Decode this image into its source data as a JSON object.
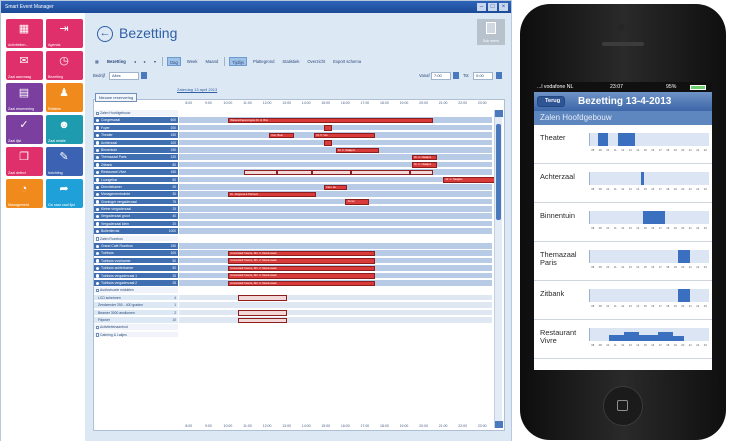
{
  "desktop": {
    "window_title": "Smart Event Manager",
    "tiles": [
      {
        "label": "Activiteiten...",
        "color": "#e0306b",
        "icon": "grid-icon",
        "glyph": "▦"
      },
      {
        "label": "Agenda",
        "color": "#e0306b",
        "icon": "door-icon",
        "glyph": "⇥"
      },
      {
        "label": "Zaal aanvraag",
        "color": "#e0306b",
        "icon": "mail-icon",
        "glyph": "✉"
      },
      {
        "label": "Bezetting",
        "color": "#e0306b",
        "icon": "clock-icon",
        "glyph": "◷"
      },
      {
        "label": "Zaal reservering",
        "color": "#7b3fa0",
        "icon": "document-icon",
        "glyph": "▤"
      },
      {
        "label": "Relaties",
        "color": "#f08a1d",
        "icon": "person-icon",
        "glyph": "♟"
      },
      {
        "label": "Zaal lijst",
        "color": "#7b3fa0",
        "icon": "check-icon",
        "glyph": "✓"
      },
      {
        "label": "Zaal relatie",
        "color": "#1f9bb0",
        "icon": "people-icon",
        "glyph": "☻"
      },
      {
        "label": "Zaal defect",
        "color": "#e0306b",
        "icon": "tag-icon",
        "glyph": "❐"
      },
      {
        "label": "Inrichting",
        "color": "#3b62b3",
        "icon": "pencil-icon",
        "glyph": "✎"
      },
      {
        "label": "Management",
        "color": "#f08a1d",
        "icon": "chart-icon",
        "glyph": "◔"
      },
      {
        "label": "Ga naar zaal lijst",
        "color": "#1fa0d8",
        "icon": "share-icon",
        "glyph": "➦"
      }
    ],
    "page_title": "Bezetting",
    "new_button_label": "Sub menu",
    "toolbar": {
      "label": "Bezetting",
      "nav": [
        "◂",
        "▸",
        "▾"
      ],
      "views": [
        "Dag",
        "Week",
        "Maand"
      ],
      "active_view": "Dag",
      "options": [
        "Tijdlijn",
        "Plattegrond",
        "Statistiek",
        "Overzicht",
        "Export schema"
      ],
      "active_option": "Tijdlijn"
    },
    "filter": {
      "label": "Bedrijf",
      "value": "Alles",
      "from_label": "Vanaf",
      "from_value": "7:00",
      "to_label": "Tot",
      "to_value": "0:00"
    },
    "new_reservation_label": "Nieuwe reservering",
    "date_link": "Zaterdag 13 april 2013",
    "hours": [
      "8:00",
      "9:00",
      "10:00",
      "11:00",
      "12:00",
      "13:00",
      "14:00",
      "15:00",
      "16:00",
      "17:00",
      "18:00",
      "19:00",
      "20:00",
      "21:00",
      "22:00",
      "23:00"
    ],
    "rows": [
      {
        "type": "group",
        "name": "Zalen Hoofdgebouw"
      },
      {
        "type": "room",
        "name": "Congreszaal",
        "cap": "600",
        "events": [
          {
            "start": 10.0,
            "end": 20.5,
            "label": "Wetenschapscongres Dr. H. Bos"
          }
        ]
      },
      {
        "type": "room",
        "name": "Foyer",
        "cap": "200",
        "events": [
          {
            "start": 14.9,
            "end": 15.3,
            "label": ""
          }
        ]
      },
      {
        "type": "room",
        "name": "Theater",
        "cap": "150",
        "events": [
          {
            "start": 12.1,
            "end": 13.4,
            "label": "Kon. Boer"
          },
          {
            "start": 14.4,
            "end": 17.5,
            "label": "Dr. P. Vos"
          }
        ]
      },
      {
        "type": "room",
        "name": "Achterzaal",
        "cap": "100",
        "events": [
          {
            "start": 14.9,
            "end": 15.3,
            "label": ""
          }
        ]
      },
      {
        "type": "room",
        "name": "Binnentuin",
        "cap": "150",
        "events": [
          {
            "start": 15.5,
            "end": 17.7,
            "label": "Dr. C. Naaijers"
          }
        ]
      },
      {
        "type": "room",
        "name": "Themazaal Paris",
        "cap": "120",
        "events": [
          {
            "start": 19.4,
            "end": 20.7,
            "label": "Dr. C. Naaijers"
          }
        ]
      },
      {
        "type": "room",
        "name": "Zitbank",
        "cap": "80",
        "events": [
          {
            "start": 19.4,
            "end": 20.7,
            "label": "Dr. C. Naaijers"
          }
        ]
      },
      {
        "type": "room",
        "name": "Restaurant Vivre",
        "cap": "150",
        "events": [
          {
            "start": 10.8,
            "end": 12.5,
            "label": "",
            "outline": true
          },
          {
            "start": 12.5,
            "end": 14.3,
            "label": "",
            "outline": true
          },
          {
            "start": 14.3,
            "end": 16.3,
            "label": "",
            "outline": true
          },
          {
            "start": 16.3,
            "end": 19.3,
            "label": "",
            "outline": true
          },
          {
            "start": 19.3,
            "end": 20.5,
            "label": "",
            "outline": true
          }
        ]
      },
      {
        "type": "room",
        "name": "Loungebar",
        "cap": "60",
        "events": [
          {
            "start": 21.0,
            "end": 23.9,
            "label": "Dr. C. Naaijers"
          }
        ]
      },
      {
        "type": "room",
        "name": "Directiekamer",
        "cap": "20",
        "events": [
          {
            "start": 14.9,
            "end": 16.1,
            "label": "Fam. de"
          }
        ]
      },
      {
        "type": "room",
        "name": "Managementruimte",
        "cap": "30",
        "events": [
          {
            "start": 10.0,
            "end": 14.5,
            "label": "Dr. Jongsma & Partners"
          }
        ]
      },
      {
        "type": "room",
        "name": "Groninger vergaderzaal",
        "cap": "75",
        "events": [
          {
            "start": 16.0,
            "end": 17.2,
            "label": "Kunst"
          }
        ]
      },
      {
        "type": "room",
        "name": "Kleine vergaderzaal",
        "cap": "25",
        "events": []
      },
      {
        "type": "room",
        "name": "Vergaderzaal groot",
        "cap": "40",
        "events": []
      },
      {
        "type": "room",
        "name": "Vergaderzaal klein",
        "cap": "20",
        "events": []
      },
      {
        "type": "room",
        "name": "Buitenterras",
        "cap": "1000",
        "events": []
      },
      {
        "type": "group",
        "name": "Zalen Rozebos"
      },
      {
        "type": "room",
        "name": "Grand Café Rozebos",
        "cap": "150",
        "events": []
      },
      {
        "type": "room",
        "name": "Tuinhuis",
        "cap": "100",
        "events": [
          {
            "start": 10.0,
            "end": 17.5,
            "label": "Universiteit Twente, Dhr. Z. Mamimsaad"
          }
        ]
      },
      {
        "type": "room",
        "name": "Tuinhuis voorkamer",
        "cap": "50",
        "events": [
          {
            "start": 10.0,
            "end": 17.5,
            "label": "Universiteit Twente, Dhr. Z. Mamimsaad"
          }
        ]
      },
      {
        "type": "room",
        "name": "Tuinhuis achterkamer",
        "cap": "50",
        "events": [
          {
            "start": 10.0,
            "end": 17.5,
            "label": "Universiteit Twente, Dhr. Z. Mamimsaad"
          }
        ]
      },
      {
        "type": "room",
        "name": "Tuinhuis vergaderzaal 1",
        "cap": "25",
        "events": [
          {
            "start": 10.0,
            "end": 17.5,
            "label": "Universiteit Twente, Dhr. Z. Mamimsaad"
          }
        ]
      },
      {
        "type": "room",
        "name": "Tuinhuis vergaderzaal 2",
        "cap": "25",
        "events": [
          {
            "start": 10.0,
            "end": 17.5,
            "label": "Universiteit Twente, Dhr. Z. Mamimsaad"
          }
        ]
      },
      {
        "type": "group",
        "name": "Audiovisuele middelen"
      },
      {
        "type": "sub",
        "name": "LCD schermen",
        "cap": "4",
        "events": [
          {
            "start": 10.5,
            "end": 13.0,
            "label": "",
            "outline": true
          }
        ]
      },
      {
        "type": "sub",
        "name": "Zendzender 250 - 400 graden",
        "cap": "1",
        "events": []
      },
      {
        "type": "sub",
        "name": "Beamer 3000 ansilumen",
        "cap": "2",
        "events": [
          {
            "start": 10.5,
            "end": 13.0,
            "label": "",
            "outline": true
          }
        ]
      },
      {
        "type": "sub",
        "name": "Flipover",
        "cap": "10",
        "events": [
          {
            "start": 10.5,
            "end": 13.0,
            "label": "",
            "outline": true
          }
        ]
      },
      {
        "type": "group",
        "name": "Activiteitenaanbod"
      },
      {
        "type": "group",
        "name": "Catering & Lakjes"
      }
    ]
  },
  "mobile": {
    "carrier": "...l vodafone NL",
    "time": "23:07",
    "battery": "95%",
    "back_label": "Terug",
    "title": "Bezetting 13-4-2013",
    "section": "Zalen Hoofdgebouw",
    "tick_labels": [
      "08",
      "09",
      "10",
      "11",
      "12",
      "13",
      "14",
      "15",
      "16",
      "17",
      "18",
      "19",
      "20",
      "21",
      "22",
      "23"
    ],
    "rooms": [
      {
        "name": "Theater",
        "blocks": [
          {
            "start": 8.6,
            "end": 9.9,
            "level": 1.0
          },
          {
            "start": 11.2,
            "end": 13.5,
            "level": 1.0
          }
        ]
      },
      {
        "name": "Achterzaal",
        "blocks": [
          {
            "start": 14.3,
            "end": 14.7,
            "level": 1.0
          }
        ]
      },
      {
        "name": "Binnentuin",
        "blocks": [
          {
            "start": 14.5,
            "end": 17.5,
            "level": 1.0
          }
        ]
      },
      {
        "name": "Themazaal Paris",
        "blocks": [
          {
            "start": 19.2,
            "end": 20.8,
            "level": 1.0
          }
        ]
      },
      {
        "name": "Zitbank",
        "blocks": [
          {
            "start": 19.2,
            "end": 20.8,
            "level": 1.0
          }
        ]
      },
      {
        "name": "Restaurant Vivre",
        "blocks": [
          {
            "start": 10.0,
            "end": 12.0,
            "level": 0.45
          },
          {
            "start": 12.0,
            "end": 14.0,
            "level": 0.7
          },
          {
            "start": 14.0,
            "end": 16.5,
            "level": 0.5
          },
          {
            "start": 16.5,
            "end": 18.5,
            "level": 0.7
          },
          {
            "start": 18.5,
            "end": 20.0,
            "level": 0.35
          }
        ]
      }
    ]
  }
}
